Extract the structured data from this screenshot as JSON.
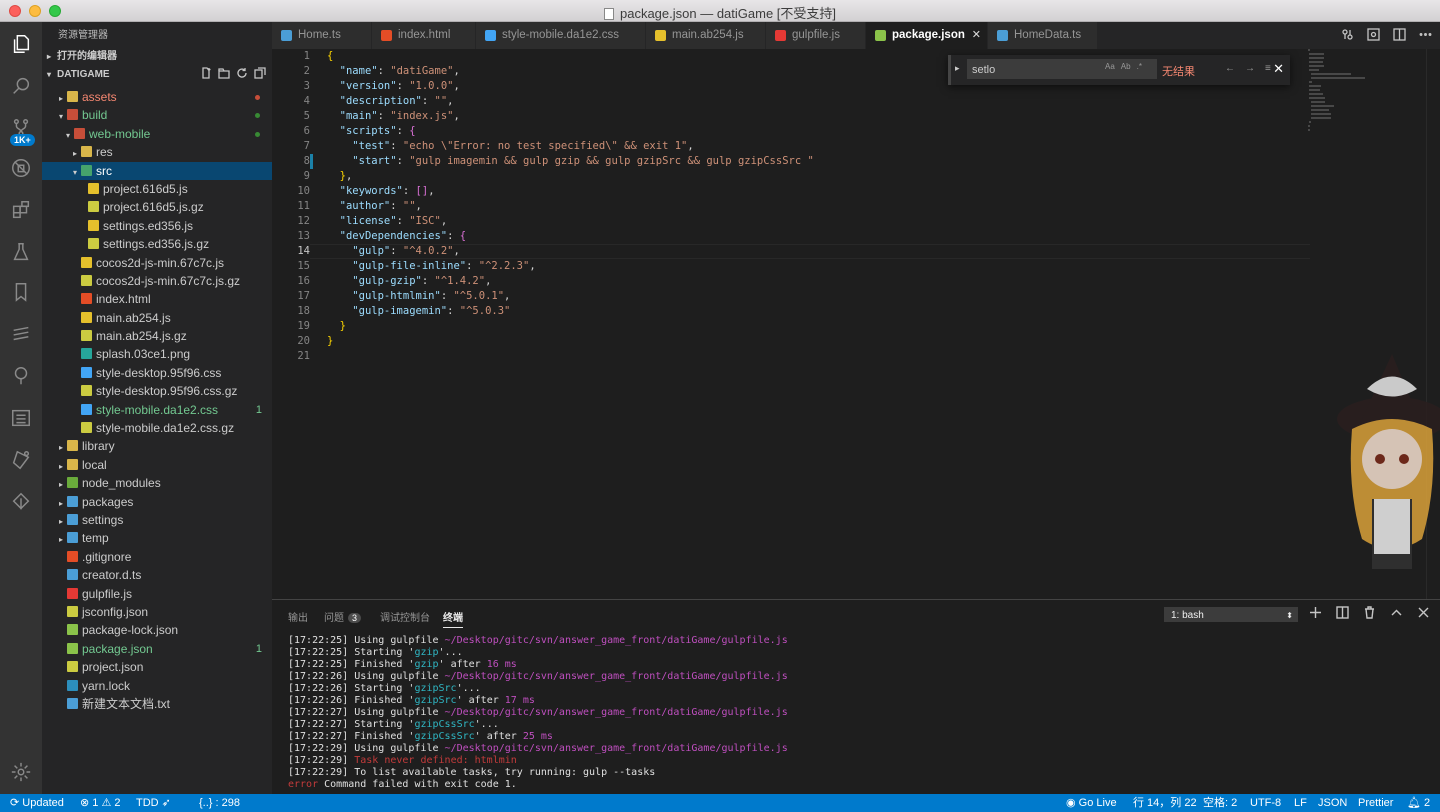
{
  "window": {
    "title": "package.json — datiGame [不受支持]"
  },
  "activity": {
    "scm_badge": "1K+"
  },
  "sidebar": {
    "header": "资源管理器",
    "open_editors": "打开的编辑器",
    "project": "DATIGAME",
    "tree": [
      {
        "label": "assets",
        "indent": 1,
        "twisty": "▸",
        "icon": "folder",
        "color": "#f48771",
        "dot": "#c74e39"
      },
      {
        "label": "build",
        "indent": 1,
        "twisty": "▾",
        "icon": "folder-open",
        "color": "#73c991",
        "dot": "#388a34"
      },
      {
        "label": "web-mobile",
        "indent": 2,
        "twisty": "▾",
        "icon": "folder-open",
        "color": "#73c991",
        "dot": "#388a34"
      },
      {
        "label": "res",
        "indent": 3,
        "twisty": "▸",
        "icon": "folder",
        "color": "#cccccc"
      },
      {
        "label": "src",
        "indent": 3,
        "twisty": "▾",
        "icon": "folder-src",
        "color": "#ffffff",
        "selected": true
      },
      {
        "label": "project.616d5.js",
        "indent": 4,
        "icon": "js",
        "color": "#cccccc"
      },
      {
        "label": "project.616d5.js.gz",
        "indent": 4,
        "icon": "gz",
        "color": "#cccccc"
      },
      {
        "label": "settings.ed356.js",
        "indent": 4,
        "icon": "js",
        "color": "#cccccc"
      },
      {
        "label": "settings.ed356.js.gz",
        "indent": 4,
        "icon": "gz",
        "color": "#cccccc"
      },
      {
        "label": "cocos2d-js-min.67c7c.js",
        "indent": 3,
        "icon": "js",
        "color": "#cccccc"
      },
      {
        "label": "cocos2d-js-min.67c7c.js.gz",
        "indent": 3,
        "icon": "gz",
        "color": "#cccccc"
      },
      {
        "label": "index.html",
        "indent": 3,
        "icon": "html",
        "color": "#cccccc"
      },
      {
        "label": "main.ab254.js",
        "indent": 3,
        "icon": "js",
        "color": "#cccccc"
      },
      {
        "label": "main.ab254.js.gz",
        "indent": 3,
        "icon": "gz",
        "color": "#cccccc"
      },
      {
        "label": "splash.03ce1.png",
        "indent": 3,
        "icon": "png",
        "color": "#cccccc"
      },
      {
        "label": "style-desktop.95f96.css",
        "indent": 3,
        "icon": "css",
        "color": "#cccccc"
      },
      {
        "label": "style-desktop.95f96.css.gz",
        "indent": 3,
        "icon": "gz",
        "color": "#cccccc"
      },
      {
        "label": "style-mobile.da1e2.css",
        "indent": 3,
        "icon": "css",
        "color": "#73c991",
        "count": "1"
      },
      {
        "label": "style-mobile.da1e2.css.gz",
        "indent": 3,
        "icon": "gz",
        "color": "#cccccc"
      },
      {
        "label": "library",
        "indent": 1,
        "twisty": "▸",
        "icon": "folder",
        "color": "#cccccc"
      },
      {
        "label": "local",
        "indent": 1,
        "twisty": "▸",
        "icon": "folder",
        "color": "#cccccc"
      },
      {
        "label": "node_modules",
        "indent": 1,
        "twisty": "▸",
        "icon": "folder-node",
        "color": "#cccccc"
      },
      {
        "label": "packages",
        "indent": 1,
        "twisty": "▸",
        "icon": "folder-pkg",
        "color": "#cccccc"
      },
      {
        "label": "settings",
        "indent": 1,
        "twisty": "▸",
        "icon": "folder-set",
        "color": "#cccccc"
      },
      {
        "label": "temp",
        "indent": 1,
        "twisty": "▸",
        "icon": "folder-temp",
        "color": "#cccccc"
      },
      {
        "label": ".gitignore",
        "indent": 1,
        "icon": "git",
        "color": "#cccccc"
      },
      {
        "label": "creator.d.ts",
        "indent": 1,
        "icon": "ts",
        "color": "#cccccc"
      },
      {
        "label": "gulpfile.js",
        "indent": 1,
        "icon": "gulp",
        "color": "#cccccc"
      },
      {
        "label": "jsconfig.json",
        "indent": 1,
        "icon": "json",
        "color": "#cccccc"
      },
      {
        "label": "package-lock.json",
        "indent": 1,
        "icon": "npm",
        "color": "#cccccc"
      },
      {
        "label": "package.json",
        "indent": 1,
        "icon": "npm",
        "color": "#73c991",
        "count": "1"
      },
      {
        "label": "project.json",
        "indent": 1,
        "icon": "json",
        "color": "#cccccc"
      },
      {
        "label": "yarn.lock",
        "indent": 1,
        "icon": "yarn",
        "color": "#cccccc"
      },
      {
        "label": "新建文本文档.txt",
        "indent": 1,
        "icon": "txt",
        "color": "#cccccc"
      }
    ]
  },
  "tabs": [
    {
      "label": "Home.ts",
      "icon": "ts"
    },
    {
      "label": "index.html",
      "icon": "html"
    },
    {
      "label": "style-mobile.da1e2.css",
      "icon": "css"
    },
    {
      "label": "main.ab254.js",
      "icon": "js"
    },
    {
      "label": "gulpfile.js",
      "icon": "gulp"
    },
    {
      "label": "package.json",
      "icon": "npm",
      "active": true
    },
    {
      "label": "HomeData.ts",
      "icon": "ts"
    }
  ],
  "find": {
    "query": "setlo",
    "opts": [
      "Aa",
      "Ab",
      ".*"
    ],
    "result": "无结果"
  },
  "editor": {
    "lines": [
      "{",
      "  \"name\": \"datiGame\",",
      "  \"version\": \"1.0.0\",",
      "  \"description\": \"\",",
      "  \"main\": \"index.js\",",
      "  \"scripts\": {",
      "    \"test\": \"echo \\\"Error: no test specified\\\" && exit 1\",",
      "    \"start\": \"gulp imagemin && gulp gzip && gulp gzipSrc && gulp gzipCssSrc \"",
      "  },",
      "  \"keywords\": [],",
      "  \"author\": \"\",",
      "  \"license\": \"ISC\",",
      "  \"devDependencies\": {",
      "    \"gulp\": \"^4.0.2\",",
      "    \"gulp-file-inline\": \"^2.2.3\",",
      "    \"gulp-gzip\": \"^1.4.2\",",
      "    \"gulp-htmlmin\": \"^5.0.1\",",
      "    \"gulp-imagemin\": \"^5.0.3\"",
      "  }",
      "}",
      ""
    ]
  },
  "panel": {
    "tabs": [
      {
        "label": "输出"
      },
      {
        "label": "问题",
        "badge": "3"
      },
      {
        "label": "调试控制台"
      },
      {
        "label": "终端",
        "active": true
      }
    ],
    "terminal_select": "1: bash",
    "terminal": [
      [
        {
          "t": "[17:22:25] Using gulpfile "
        },
        {
          "t": "~/Desktop/gitc/svn/answer_game_front/datiGame/gulpfile.js",
          "c": "tm"
        }
      ],
      [
        {
          "t": "[17:22:25] Starting '"
        },
        {
          "t": "gzip",
          "c": "tc"
        },
        {
          "t": "'..."
        }
      ],
      [
        {
          "t": "[17:22:25] Finished '"
        },
        {
          "t": "gzip",
          "c": "tc"
        },
        {
          "t": "' after "
        },
        {
          "t": "16 ms",
          "c": "tm"
        }
      ],
      [
        {
          "t": "[17:22:26] Using gulpfile "
        },
        {
          "t": "~/Desktop/gitc/svn/answer_game_front/datiGame/gulpfile.js",
          "c": "tm"
        }
      ],
      [
        {
          "t": "[17:22:26] Starting '"
        },
        {
          "t": "gzipSrc",
          "c": "tc"
        },
        {
          "t": "'..."
        }
      ],
      [
        {
          "t": "[17:22:26] Finished '"
        },
        {
          "t": "gzipSrc",
          "c": "tc"
        },
        {
          "t": "' after "
        },
        {
          "t": "17 ms",
          "c": "tm"
        }
      ],
      [
        {
          "t": "[17:22:27] Using gulpfile "
        },
        {
          "t": "~/Desktop/gitc/svn/answer_game_front/datiGame/gulpfile.js",
          "c": "tm"
        }
      ],
      [
        {
          "t": "[17:22:27] Starting '"
        },
        {
          "t": "gzipCssSrc",
          "c": "tc"
        },
        {
          "t": "'..."
        }
      ],
      [
        {
          "t": "[17:22:27] Finished '"
        },
        {
          "t": "gzipCssSrc",
          "c": "tc"
        },
        {
          "t": "' after "
        },
        {
          "t": "25 ms",
          "c": "tm"
        }
      ],
      [
        {
          "t": "[17:22:29] Using gulpfile "
        },
        {
          "t": "~/Desktop/gitc/svn/answer_game_front/datiGame/gulpfile.js",
          "c": "tm"
        }
      ],
      [
        {
          "t": "[17:22:29] "
        },
        {
          "t": "Task never defined: htmlmin",
          "c": "tr"
        }
      ],
      [
        {
          "t": "[17:22:29] To list available tasks, try running: gulp --tasks"
        }
      ],
      [
        {
          "t": "error",
          "c": "tr"
        },
        {
          "t": " Command failed with exit code 1."
        }
      ]
    ]
  },
  "status": {
    "sync": "Updated",
    "errors": "1",
    "warnings": "2",
    "tdd": "TDD",
    "braces": "{..} : 298",
    "golive": "Go Live",
    "position": "行 14，列 22",
    "spaces": "空格: 2",
    "encoding": "UTF-8",
    "eol": "LF",
    "language": "JSON",
    "prettier": "Prettier",
    "notifications": "2"
  }
}
